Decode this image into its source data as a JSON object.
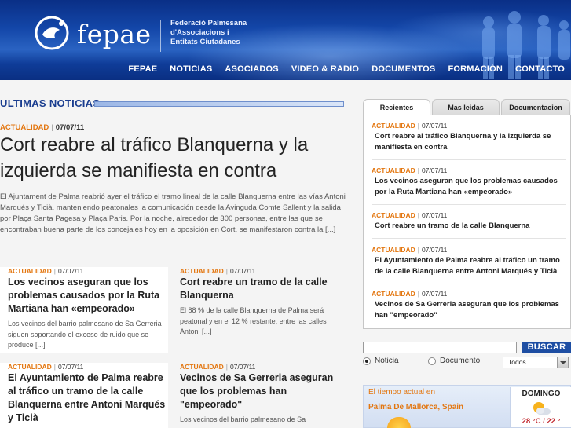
{
  "header": {
    "logo_text": "fepae",
    "org_line1": "Federació Palmesana",
    "org_line2": "d'Associacions i",
    "org_line3": "Entitats Ciutadanes",
    "nav": [
      "FEPAE",
      "NOTICIAS",
      "ASOCIADOS",
      "VIDEO & RADIO",
      "DOCUMENTOS",
      "FORMACIÓN",
      "CONTACTO"
    ]
  },
  "main": {
    "section_title": "ULTIMAS NOTICIAS",
    "lead": {
      "category": "ACTUALIDAD",
      "date": "07/07/11",
      "title": "Cort reabre al tráfico Blanquerna y la izquierda se manifiesta en contra",
      "body": "El Ajuntament de Palma reabrió ayer el tráfico el tramo lineal de la calle Blanquerna entre las vías Antoni Marqués y Ticià, manteniendo peatonales la comunicación desde la Avinguda Comte Sallent y la salida por Plaça Santa Pagesa y Plaça Paris. Por la noche, alrededor de 300 personas, entre las que se encontraban buena parte de los concejales hoy en la oposición en Cort, se manifestaron contra la [...]"
    },
    "cards": [
      {
        "category": "ACTUALIDAD",
        "date": "07/07/11",
        "title": "Los vecinos aseguran que los problemas causados por la Ruta Martiana han «empeorado»",
        "excerpt": "Los vecinos del barrio palmesano de Sa Gerreria siguen soportando el exceso de ruido que se produce [...]"
      },
      {
        "category": "ACTUALIDAD",
        "date": "07/07/11",
        "title": "Cort reabre un tramo de la calle Blanquerna",
        "excerpt": "El 88 % de la calle Blanquerna de Palma será peatonal y en el 12 % restante, entre las calles Antoni [...]"
      },
      {
        "category": "ACTUALIDAD",
        "date": "07/07/11",
        "title": "El Ayuntamiento de Palma reabre al tráfico un tramo de la calle Blanquerna entre Antoni Marqués y Ticià",
        "excerpt": ""
      },
      {
        "category": "ACTUALIDAD",
        "date": "07/07/11",
        "title": "Vecinos de Sa Gerreria aseguran que los problemas han \"empeorado\"",
        "excerpt": "Los vecinos del barrio palmesano de Sa"
      }
    ]
  },
  "sidebar": {
    "tabs": [
      "Recientes",
      "Mas leidas",
      "Documentacion"
    ],
    "items": [
      {
        "category": "ACTUALIDAD",
        "date": "07/07/11",
        "title": "Cort reabre al tráfico Blanquerna y la izquierda se manifiesta en contra"
      },
      {
        "category": "ACTUALIDAD",
        "date": "07/07/11",
        "title": "Los vecinos aseguran que los problemas causados por la Ruta Martiana han «empeorado»"
      },
      {
        "category": "ACTUALIDAD",
        "date": "07/07/11",
        "title": "Cort reabre un tramo de la calle Blanquerna"
      },
      {
        "category": "ACTUALIDAD",
        "date": "07/07/11",
        "title": "El Ayuntamiento de Palma reabre al tráfico un tramo de la calle Blanquerna entre Antoni Marqués y Ticià"
      },
      {
        "category": "ACTUALIDAD",
        "date": "07/07/11",
        "title": "Vecinos de Sa Gerreria aseguran que los problemas han \"empeorado\""
      }
    ],
    "search": {
      "value": "",
      "button": "BUSCAR",
      "radio_news": "Noticia",
      "radio_docs": "Documento",
      "selected_radio": "Noticia",
      "select_value": "Todos"
    },
    "weather": {
      "title": "El tiempo actual en",
      "city": "Palma De Mallorca, Spain",
      "day": "DOMINGO",
      "temp": "28 °C / 22 °"
    }
  },
  "colors": {
    "accent_orange": "#e3760f",
    "header_blue": "#1346a8",
    "search_button": "#1e4ea3",
    "section_title": "#1a3d8f"
  }
}
